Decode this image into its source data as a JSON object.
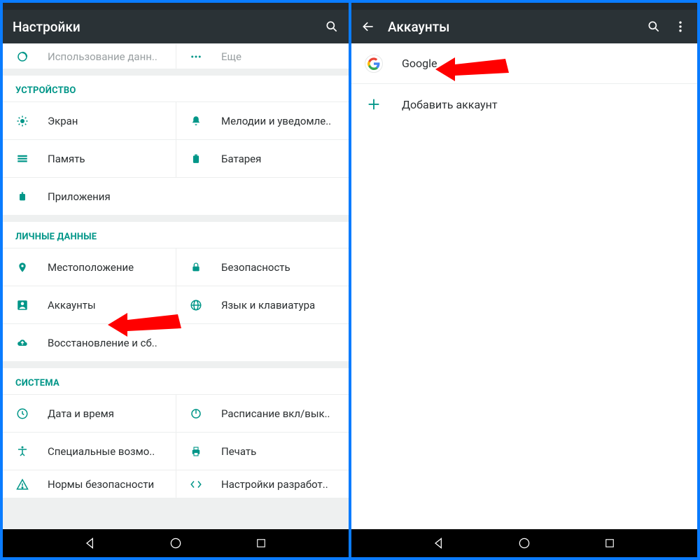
{
  "left": {
    "title": "Настройки",
    "truncated_top": {
      "label": "Использование данн..",
      "more": "Еще"
    },
    "sections": [
      {
        "header": "УСТРОЙСТВО",
        "items": [
          {
            "icon": "brightness-icon",
            "label": "Экран"
          },
          {
            "icon": "bell-icon",
            "label": "Мелодии и уведомле.."
          },
          {
            "icon": "storage-icon",
            "label": "Память"
          },
          {
            "icon": "battery-icon",
            "label": "Батарея"
          },
          {
            "icon": "apps-icon",
            "label": "Приложения",
            "full": true
          }
        ]
      },
      {
        "header": "ЛИЧНЫЕ ДАННЫЕ",
        "items": [
          {
            "icon": "location-icon",
            "label": "Местоположение"
          },
          {
            "icon": "lock-icon",
            "label": "Безопасность"
          },
          {
            "icon": "account-icon",
            "label": "Аккаунты"
          },
          {
            "icon": "globe-icon",
            "label": "Язык и клавиатура"
          },
          {
            "icon": "backup-icon",
            "label": "Восстановление и сб..",
            "full": true
          }
        ]
      },
      {
        "header": "СИСТЕМА",
        "items": [
          {
            "icon": "clock-icon",
            "label": "Дата и время"
          },
          {
            "icon": "power-icon",
            "label": "Расписание вкл/вык.."
          },
          {
            "icon": "accessibility-icon",
            "label": "Специальные возмо.."
          },
          {
            "icon": "print-icon",
            "label": "Печать"
          },
          {
            "icon": "warning-icon",
            "label": "Нормы безопасности"
          },
          {
            "icon": "devopts-icon",
            "label": "Настройки разработ.."
          }
        ]
      }
    ]
  },
  "right": {
    "title": "Аккаунты",
    "items": [
      {
        "icon": "google-logo",
        "label": "Google"
      },
      {
        "icon": "plus-icon",
        "label": "Добавить аккаунт"
      }
    ]
  }
}
